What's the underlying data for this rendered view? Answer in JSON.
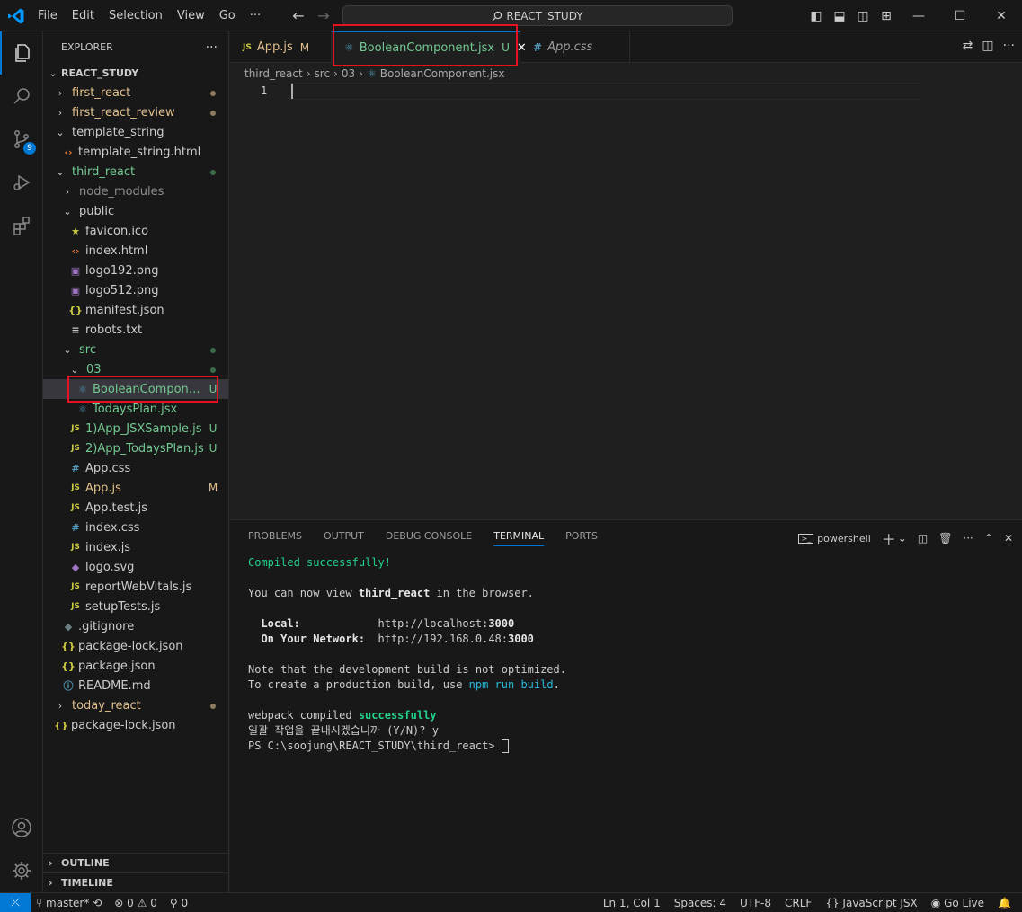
{
  "titlebar": {
    "menu": [
      "File",
      "Edit",
      "Selection",
      "View",
      "Go",
      "···"
    ],
    "search_text": "REACT_STUDY"
  },
  "activity": {
    "source_control_badge": "9"
  },
  "sidebar": {
    "title": "EXPLORER",
    "root": "REACT_STUDY",
    "outline_label": "OUTLINE",
    "timeline_label": "TIMELINE",
    "tree": [
      {
        "label": "first_react",
        "kind": "folder-closed",
        "indent": 0,
        "color": "modified",
        "deco": "dot-modified"
      },
      {
        "label": "first_react_review",
        "kind": "folder-closed",
        "indent": 0,
        "color": "modified",
        "deco": "dot-modified"
      },
      {
        "label": "template_string",
        "kind": "folder-open",
        "indent": 0,
        "color": "default",
        "deco": ""
      },
      {
        "label": "template_string.html",
        "kind": "html",
        "indent": 1,
        "color": "default",
        "deco": ""
      },
      {
        "label": "third_react",
        "kind": "folder-open",
        "indent": 0,
        "color": "green",
        "deco": "dot-green"
      },
      {
        "label": "node_modules",
        "kind": "folder-closed",
        "indent": 1,
        "color": "gray",
        "deco": ""
      },
      {
        "label": "public",
        "kind": "folder-open",
        "indent": 1,
        "color": "default",
        "deco": ""
      },
      {
        "label": "favicon.ico",
        "kind": "star",
        "indent": 2,
        "color": "default",
        "deco": ""
      },
      {
        "label": "index.html",
        "kind": "html",
        "indent": 2,
        "color": "default",
        "deco": ""
      },
      {
        "label": "logo192.png",
        "kind": "image",
        "indent": 2,
        "color": "default",
        "deco": ""
      },
      {
        "label": "logo512.png",
        "kind": "image",
        "indent": 2,
        "color": "default",
        "deco": ""
      },
      {
        "label": "manifest.json",
        "kind": "json",
        "indent": 2,
        "color": "default",
        "deco": ""
      },
      {
        "label": "robots.txt",
        "kind": "txt",
        "indent": 2,
        "color": "default",
        "deco": ""
      },
      {
        "label": "src",
        "kind": "folder-open",
        "indent": 1,
        "color": "green",
        "deco": "dot-green"
      },
      {
        "label": "03",
        "kind": "folder-open",
        "indent": 2,
        "color": "green",
        "deco": "dot-green"
      },
      {
        "label": "BooleanCompone...",
        "kind": "react",
        "indent": 3,
        "color": "green",
        "deco": "U",
        "selected": true
      },
      {
        "label": "TodaysPlan.jsx",
        "kind": "react",
        "indent": 3,
        "color": "green",
        "deco": ""
      },
      {
        "label": "1)App_JSXSample.js",
        "kind": "js",
        "indent": 2,
        "color": "green",
        "deco": "U"
      },
      {
        "label": "2)App_TodaysPlan.js",
        "kind": "js",
        "indent": 2,
        "color": "green",
        "deco": "U"
      },
      {
        "label": "App.css",
        "kind": "css",
        "indent": 2,
        "color": "default",
        "deco": ""
      },
      {
        "label": "App.js",
        "kind": "js",
        "indent": 2,
        "color": "modified",
        "deco": "M"
      },
      {
        "label": "App.test.js",
        "kind": "js",
        "indent": 2,
        "color": "default",
        "deco": ""
      },
      {
        "label": "index.css",
        "kind": "css",
        "indent": 2,
        "color": "default",
        "deco": ""
      },
      {
        "label": "index.js",
        "kind": "js",
        "indent": 2,
        "color": "default",
        "deco": ""
      },
      {
        "label": "logo.svg",
        "kind": "svg",
        "indent": 2,
        "color": "default",
        "deco": ""
      },
      {
        "label": "reportWebVitals.js",
        "kind": "js",
        "indent": 2,
        "color": "default",
        "deco": ""
      },
      {
        "label": "setupTests.js",
        "kind": "js",
        "indent": 2,
        "color": "default",
        "deco": ""
      },
      {
        "label": ".gitignore",
        "kind": "git",
        "indent": 1,
        "color": "default",
        "deco": ""
      },
      {
        "label": "package-lock.json",
        "kind": "json",
        "indent": 1,
        "color": "default",
        "deco": ""
      },
      {
        "label": "package.json",
        "kind": "json",
        "indent": 1,
        "color": "default",
        "deco": ""
      },
      {
        "label": "README.md",
        "kind": "info",
        "indent": 1,
        "color": "default",
        "deco": ""
      },
      {
        "label": "today_react",
        "kind": "folder-closed",
        "indent": 0,
        "color": "modified",
        "deco": "dot-modified"
      },
      {
        "label": "package-lock.json",
        "kind": "json",
        "indent": 0,
        "color": "default",
        "deco": ""
      }
    ]
  },
  "tabs": [
    {
      "label": "App.js",
      "icon": "JS",
      "mark": "M",
      "active": false
    },
    {
      "label": "BooleanComponent.jsx",
      "icon": "react",
      "mark": "U",
      "active": true
    },
    {
      "label": "App.css",
      "icon": "#",
      "mark": "",
      "active": false
    }
  ],
  "breadcrumb": [
    "third_react",
    "src",
    "03",
    "BooleanComponent.jsx"
  ],
  "editor": {
    "line_number": "1"
  },
  "panel": {
    "tabs": [
      "PROBLEMS",
      "OUTPUT",
      "DEBUG CONSOLE",
      "TERMINAL",
      "PORTS"
    ],
    "active_tab": "TERMINAL",
    "shell": "powershell",
    "terminal": {
      "compiled": "Compiled successfully!",
      "view_prefix": "You can now view ",
      "view_app": "third_react",
      "view_suffix": " in the browser.",
      "local_label": "  Local:",
      "local_url_prefix": "            http://localhost:",
      "local_port": "3000",
      "network_label": "  On Your Network:",
      "network_url_prefix": "  http://192.168.0.48:",
      "network_port": "3000",
      "note1": "Note that the development build is not optimized.",
      "note2_prefix": "To create a production build, use ",
      "note2_cmd": "npm run build",
      "note2_suffix": ".",
      "webpack_prefix": "webpack compiled ",
      "webpack_status": "successfully",
      "korean": "일괄 작업을 끝내시겠습니까 (Y/N)? y",
      "prompt": "PS C:\\soojung\\REACT_STUDY\\third_react> "
    }
  },
  "status": {
    "branch": "master*",
    "errors": "0",
    "warnings": "0",
    "ports": "0",
    "position": "Ln 1, Col 1",
    "spaces": "Spaces: 4",
    "encoding": "UTF-8",
    "eol": "CRLF",
    "language": "JavaScript JSX",
    "golive": "Go Live"
  },
  "colors": {
    "accent": "#0078d4",
    "highlight_box": "#e81123",
    "git_added": "#73c991",
    "git_modified": "#e2c08d"
  }
}
